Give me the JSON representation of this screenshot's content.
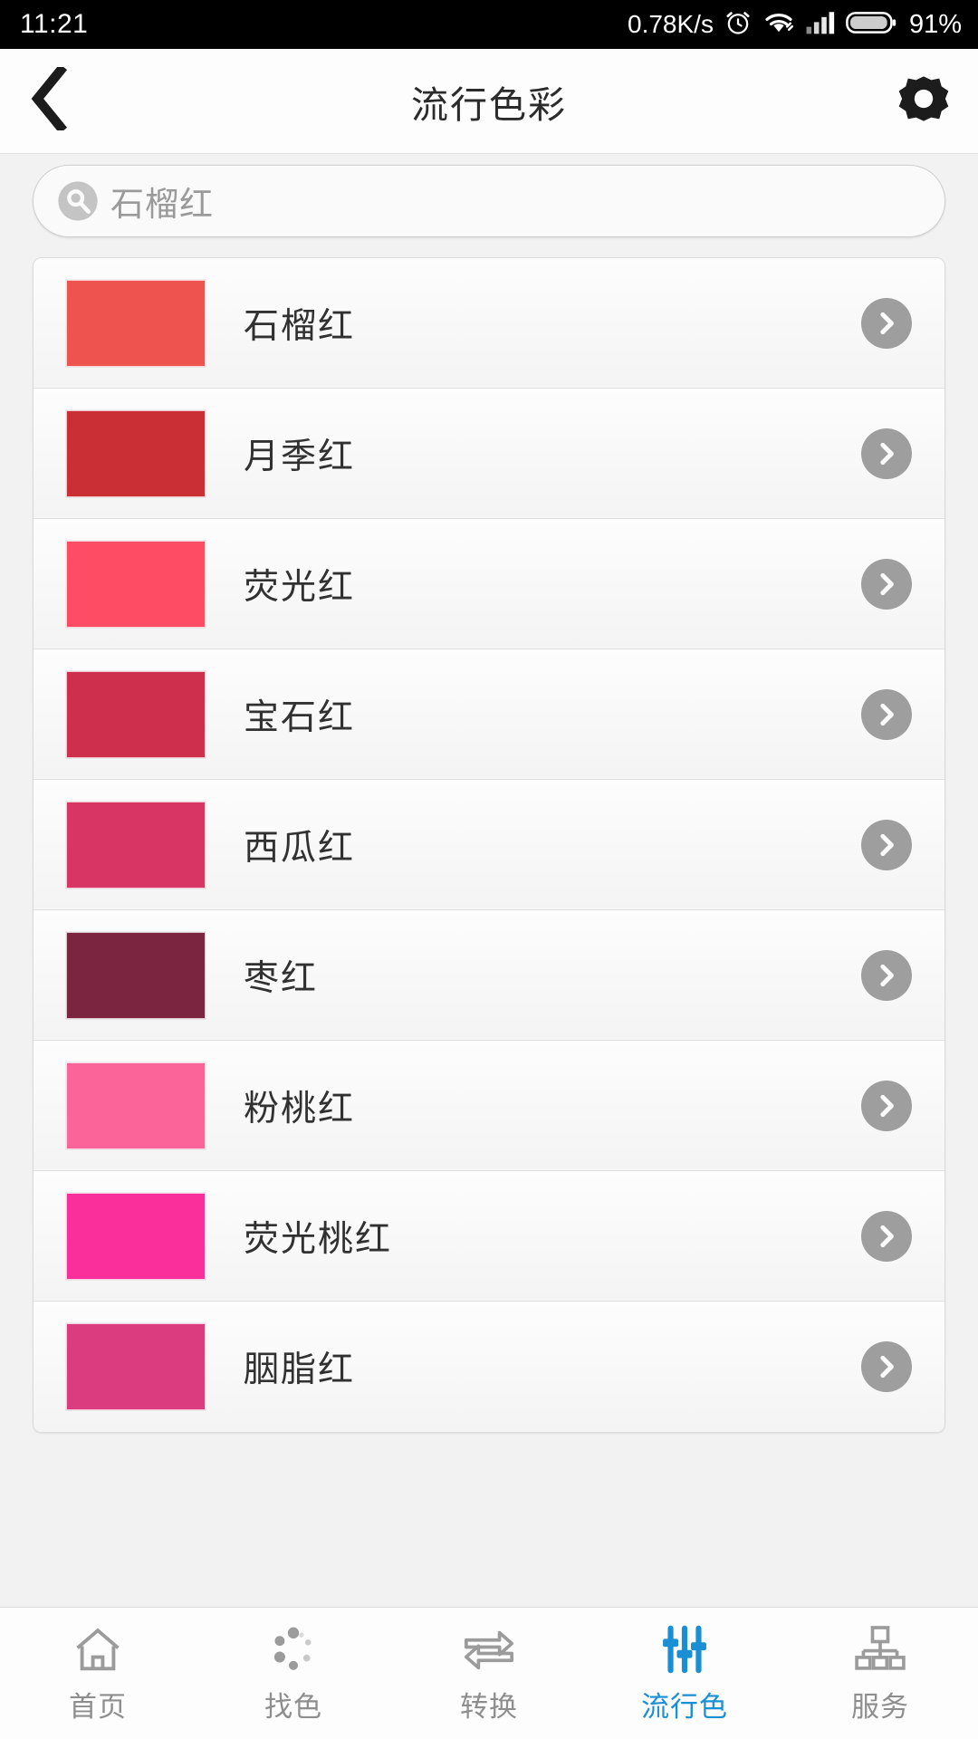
{
  "statusbar": {
    "time": "11:21",
    "net_speed": "0.78K/s",
    "battery_percent": "91%",
    "icons": [
      "alarm-icon",
      "wifi-icon",
      "signal-icon",
      "battery-icon"
    ]
  },
  "header": {
    "title": "流行色彩",
    "back_icon": "back-chevron-icon",
    "settings_icon": "gear-icon"
  },
  "search": {
    "value": "石榴红",
    "placeholder": "石榴红",
    "icon": "search-icon"
  },
  "list": {
    "chevron_icon": "chevron-right-icon",
    "items": [
      {
        "name": "石榴红",
        "color": "#ee5350"
      },
      {
        "name": "月季红",
        "color": "#c92f35"
      },
      {
        "name": "荧光红",
        "color": "#fd4c63"
      },
      {
        "name": "宝石红",
        "color": "#ce2f4d"
      },
      {
        "name": "西瓜红",
        "color": "#d93564"
      },
      {
        "name": "枣红",
        "color": "#7b2541"
      },
      {
        "name": "粉桃红",
        "color": "#fb6499"
      },
      {
        "name": "荧光桃红",
        "color": "#fb2f9b"
      },
      {
        "name": "胭脂红",
        "color": "#db3c7f"
      }
    ]
  },
  "tabbar": {
    "active_color": "#1b8fd4",
    "items": [
      {
        "label": "首页",
        "icon": "home-icon",
        "active": false
      },
      {
        "label": "找色",
        "icon": "dots-circle-icon",
        "active": false
      },
      {
        "label": "转换",
        "icon": "swap-arrows-icon",
        "active": false
      },
      {
        "label": "流行色",
        "icon": "sliders-icon",
        "active": true
      },
      {
        "label": "服务",
        "icon": "sitemap-icon",
        "active": false
      }
    ]
  }
}
